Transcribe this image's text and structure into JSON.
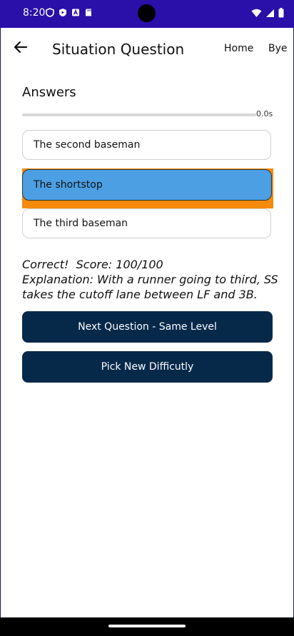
{
  "status_bar": {
    "time": "8:20",
    "colors": {
      "background": "#2a0fa8"
    }
  },
  "header": {
    "title": "Situation Question",
    "nav": {
      "home": "Home",
      "bye": "Bye"
    }
  },
  "answers_section": {
    "title": "Answers",
    "timer": {
      "label": "0.0s",
      "progress_fraction": 0.0
    },
    "options": [
      {
        "label": "The second baseman",
        "selected": false
      },
      {
        "label": "The shortstop",
        "selected": true
      },
      {
        "label": "The third baseman",
        "selected": false
      }
    ]
  },
  "result": {
    "line1": "Correct!  Score: 100/100",
    "line2": "Explanation: With a runner going to third, SS",
    "line3": "takes the cutoff lane between LF and 3B."
  },
  "actions": {
    "next_question": "Next Question - Same Level",
    "pick_difficulty": "Pick New Difficutly"
  },
  "colors": {
    "button": "#06294a",
    "selected_answer": "#4c9fe3",
    "selected_highlight": "#f58a0b"
  },
  "icons": [
    "back-arrow-icon",
    "shield-icon",
    "play-protect-icon",
    "a-icon",
    "sd-card-icon",
    "wifi-icon",
    "signal-icon",
    "battery-icon"
  ]
}
